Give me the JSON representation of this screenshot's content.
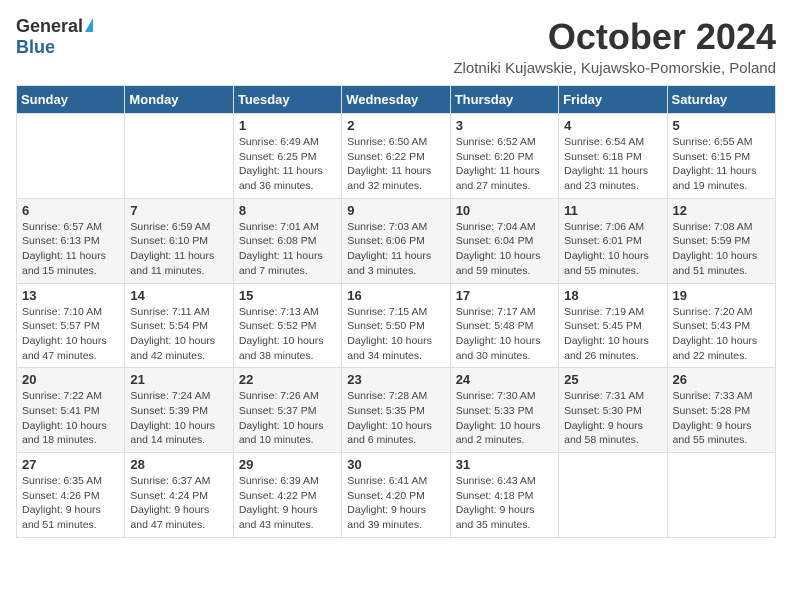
{
  "logo": {
    "general": "General",
    "blue": "Blue"
  },
  "title": {
    "month": "October 2024",
    "location": "Zlotniki Kujawskie, Kujawsko-Pomorskie, Poland"
  },
  "weekdays": [
    "Sunday",
    "Monday",
    "Tuesday",
    "Wednesday",
    "Thursday",
    "Friday",
    "Saturday"
  ],
  "weeks": [
    [
      {
        "day": "",
        "info": ""
      },
      {
        "day": "",
        "info": ""
      },
      {
        "day": "1",
        "info": "Sunrise: 6:49 AM\nSunset: 6:25 PM\nDaylight: 11 hours and 36 minutes."
      },
      {
        "day": "2",
        "info": "Sunrise: 6:50 AM\nSunset: 6:22 PM\nDaylight: 11 hours and 32 minutes."
      },
      {
        "day": "3",
        "info": "Sunrise: 6:52 AM\nSunset: 6:20 PM\nDaylight: 11 hours and 27 minutes."
      },
      {
        "day": "4",
        "info": "Sunrise: 6:54 AM\nSunset: 6:18 PM\nDaylight: 11 hours and 23 minutes."
      },
      {
        "day": "5",
        "info": "Sunrise: 6:55 AM\nSunset: 6:15 PM\nDaylight: 11 hours and 19 minutes."
      }
    ],
    [
      {
        "day": "6",
        "info": "Sunrise: 6:57 AM\nSunset: 6:13 PM\nDaylight: 11 hours and 15 minutes."
      },
      {
        "day": "7",
        "info": "Sunrise: 6:59 AM\nSunset: 6:10 PM\nDaylight: 11 hours and 11 minutes."
      },
      {
        "day": "8",
        "info": "Sunrise: 7:01 AM\nSunset: 6:08 PM\nDaylight: 11 hours and 7 minutes."
      },
      {
        "day": "9",
        "info": "Sunrise: 7:03 AM\nSunset: 6:06 PM\nDaylight: 11 hours and 3 minutes."
      },
      {
        "day": "10",
        "info": "Sunrise: 7:04 AM\nSunset: 6:04 PM\nDaylight: 10 hours and 59 minutes."
      },
      {
        "day": "11",
        "info": "Sunrise: 7:06 AM\nSunset: 6:01 PM\nDaylight: 10 hours and 55 minutes."
      },
      {
        "day": "12",
        "info": "Sunrise: 7:08 AM\nSunset: 5:59 PM\nDaylight: 10 hours and 51 minutes."
      }
    ],
    [
      {
        "day": "13",
        "info": "Sunrise: 7:10 AM\nSunset: 5:57 PM\nDaylight: 10 hours and 47 minutes."
      },
      {
        "day": "14",
        "info": "Sunrise: 7:11 AM\nSunset: 5:54 PM\nDaylight: 10 hours and 42 minutes."
      },
      {
        "day": "15",
        "info": "Sunrise: 7:13 AM\nSunset: 5:52 PM\nDaylight: 10 hours and 38 minutes."
      },
      {
        "day": "16",
        "info": "Sunrise: 7:15 AM\nSunset: 5:50 PM\nDaylight: 10 hours and 34 minutes."
      },
      {
        "day": "17",
        "info": "Sunrise: 7:17 AM\nSunset: 5:48 PM\nDaylight: 10 hours and 30 minutes."
      },
      {
        "day": "18",
        "info": "Sunrise: 7:19 AM\nSunset: 5:45 PM\nDaylight: 10 hours and 26 minutes."
      },
      {
        "day": "19",
        "info": "Sunrise: 7:20 AM\nSunset: 5:43 PM\nDaylight: 10 hours and 22 minutes."
      }
    ],
    [
      {
        "day": "20",
        "info": "Sunrise: 7:22 AM\nSunset: 5:41 PM\nDaylight: 10 hours and 18 minutes."
      },
      {
        "day": "21",
        "info": "Sunrise: 7:24 AM\nSunset: 5:39 PM\nDaylight: 10 hours and 14 minutes."
      },
      {
        "day": "22",
        "info": "Sunrise: 7:26 AM\nSunset: 5:37 PM\nDaylight: 10 hours and 10 minutes."
      },
      {
        "day": "23",
        "info": "Sunrise: 7:28 AM\nSunset: 5:35 PM\nDaylight: 10 hours and 6 minutes."
      },
      {
        "day": "24",
        "info": "Sunrise: 7:30 AM\nSunset: 5:33 PM\nDaylight: 10 hours and 2 minutes."
      },
      {
        "day": "25",
        "info": "Sunrise: 7:31 AM\nSunset: 5:30 PM\nDaylight: 9 hours and 58 minutes."
      },
      {
        "day": "26",
        "info": "Sunrise: 7:33 AM\nSunset: 5:28 PM\nDaylight: 9 hours and 55 minutes."
      }
    ],
    [
      {
        "day": "27",
        "info": "Sunrise: 6:35 AM\nSunset: 4:26 PM\nDaylight: 9 hours and 51 minutes."
      },
      {
        "day": "28",
        "info": "Sunrise: 6:37 AM\nSunset: 4:24 PM\nDaylight: 9 hours and 47 minutes."
      },
      {
        "day": "29",
        "info": "Sunrise: 6:39 AM\nSunset: 4:22 PM\nDaylight: 9 hours and 43 minutes."
      },
      {
        "day": "30",
        "info": "Sunrise: 6:41 AM\nSunset: 4:20 PM\nDaylight: 9 hours and 39 minutes."
      },
      {
        "day": "31",
        "info": "Sunrise: 6:43 AM\nSunset: 4:18 PM\nDaylight: 9 hours and 35 minutes."
      },
      {
        "day": "",
        "info": ""
      },
      {
        "day": "",
        "info": ""
      }
    ]
  ]
}
